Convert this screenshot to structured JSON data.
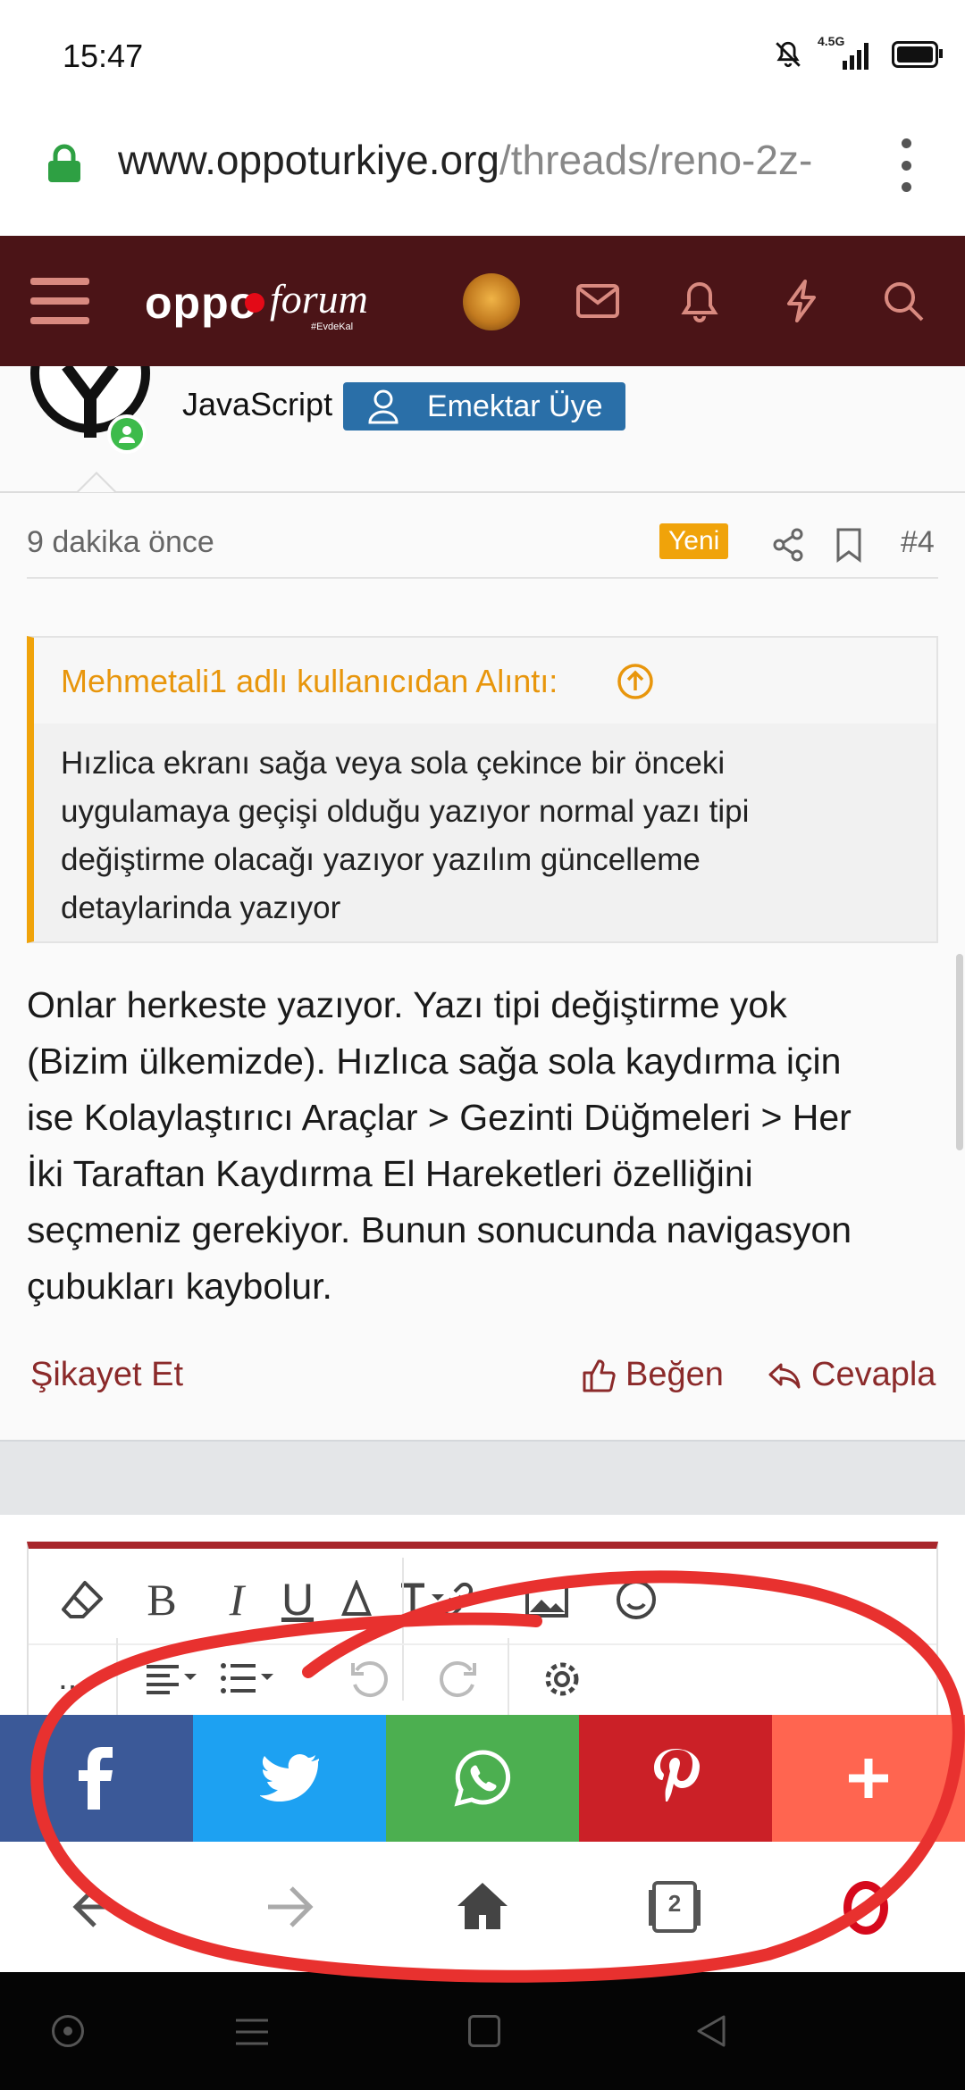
{
  "status_bar": {
    "time": "15:47",
    "network": "4.5G"
  },
  "browser": {
    "url_domain": "www.oppoturkiye.org",
    "url_path": "/threads/reno-2z-"
  },
  "forum_header": {
    "logo_text": "oppo",
    "logo_script": "forum",
    "logo_tag": "#EvdeKal"
  },
  "post": {
    "author_signature": "JavaScript",
    "role_badge": "Emektar Üye",
    "time_ago": "9 dakika önce",
    "new_badge": "Yeni",
    "post_number": "#4",
    "quote": {
      "header": "Mehmetali1 adlı kullanıcıdan Alıntı:",
      "lines": [
        "Hızlica ekranı sağa veya sola çekince bir önceki",
        "uygulamaya geçişi olduğu yazıyor normal yazı tipi",
        "değiştirme olacağı yazıyor yazılım güncelleme",
        "detaylarinda yazıyor"
      ]
    },
    "body_lines": [
      "Onlar herkeste yazıyor. Yazı tipi değiştirme yok",
      "(Bizim ülkemizde). Hızlıca sağa sola kaydırma için",
      "ise Kolaylaştırıcı Araçlar > Gezinti Düğmeleri > Her",
      "İki Taraftan Kaydırma El Hareketleri özelliğini",
      "seçmeniz gerekiyor. Bunun sonucunda navigasyon",
      "çubukları kaybolur."
    ],
    "actions": {
      "report": "Şikayet Et",
      "like": "Beğen",
      "reply": "Cevapla"
    }
  },
  "editor": {
    "bold": "B",
    "italic": "I",
    "underline": "U",
    "more": "..."
  },
  "share": {
    "colors": {
      "facebook": "#3b5998",
      "twitter": "#1da1f2",
      "whatsapp": "#4caf50",
      "pinterest": "#cb2027",
      "more": "#ff6550"
    }
  },
  "browser_nav": {
    "tab_count": "2"
  },
  "annotation": {
    "color": "#e8312f"
  }
}
